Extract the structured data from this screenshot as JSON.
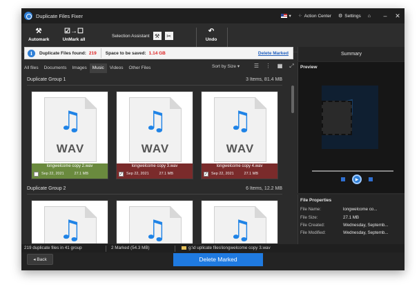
{
  "app": {
    "title": "Duplicate Files Fixer"
  },
  "titlebar": {
    "action_center": "Action Center",
    "settings": "Settings",
    "icons": [
      "flag-us-icon",
      "gear-icon",
      "store-icon",
      "minimize-icon",
      "close-icon"
    ]
  },
  "toolbar": {
    "automark": "Automark",
    "unmark_all": "UnMark all",
    "selection_assistant": "Selection Assistant",
    "undo": "Undo"
  },
  "infobar": {
    "found_label": "Duplicate Files found:",
    "found_value": "219",
    "space_label": "Space to be saved:",
    "space_value": "1.14 GB",
    "delete_link": "Delete Marked"
  },
  "tabs": [
    {
      "label": "All files"
    },
    {
      "label": "Documents"
    },
    {
      "label": "Images"
    },
    {
      "label": "Music",
      "active": true
    },
    {
      "label": "Videos"
    },
    {
      "label": "Other Files"
    }
  ],
  "sort_by": "Sort by Size",
  "groups": [
    {
      "title": "Duplicate Group 1",
      "count": "3 Items, 81.4 MB",
      "files": [
        {
          "name": "longwelcome copy 2.wav",
          "date": "Sep 22, 2021",
          "size": "27.1 MB",
          "marked": false,
          "ext": "WAV"
        },
        {
          "name": "longwelcome copy 3.wav",
          "date": "Sep 22, 2021",
          "size": "27.1 MB",
          "marked": true,
          "ext": "WAV"
        },
        {
          "name": "longwelcome copy 4.wav",
          "date": "Sep 22, 2021",
          "size": "27.1 MB",
          "marked": true,
          "ext": "WAV"
        }
      ]
    },
    {
      "title": "Duplicate Group 2",
      "count": "6 Items, 12.2 MB"
    }
  ],
  "summary": {
    "heading": "Summary",
    "preview_label": "Preview",
    "props_title": "File Properties",
    "props": [
      {
        "label": "File Name:",
        "value": "longwelcome co..."
      },
      {
        "label": "File Size:",
        "value": "27.1 MB"
      },
      {
        "label": "File Created:",
        "value": "Wednesday, Septemb..."
      },
      {
        "label": "File Modified:",
        "value": "Wednesday, Septemb..."
      }
    ]
  },
  "status": {
    "left": "219 duplicate files in 41 group",
    "middle": "2 Marked (54.3 MB)",
    "path": "g:\\d uplicate files\\longwelcome copy 3.wav"
  },
  "bottom": {
    "back": "Back",
    "delete": "Delete Marked"
  },
  "colors": {
    "accent": "#1f7ae0",
    "unmarked_footer": "#6a8a3e",
    "marked_footer": "#7a2b2b",
    "alert_red": "#dd2222"
  }
}
